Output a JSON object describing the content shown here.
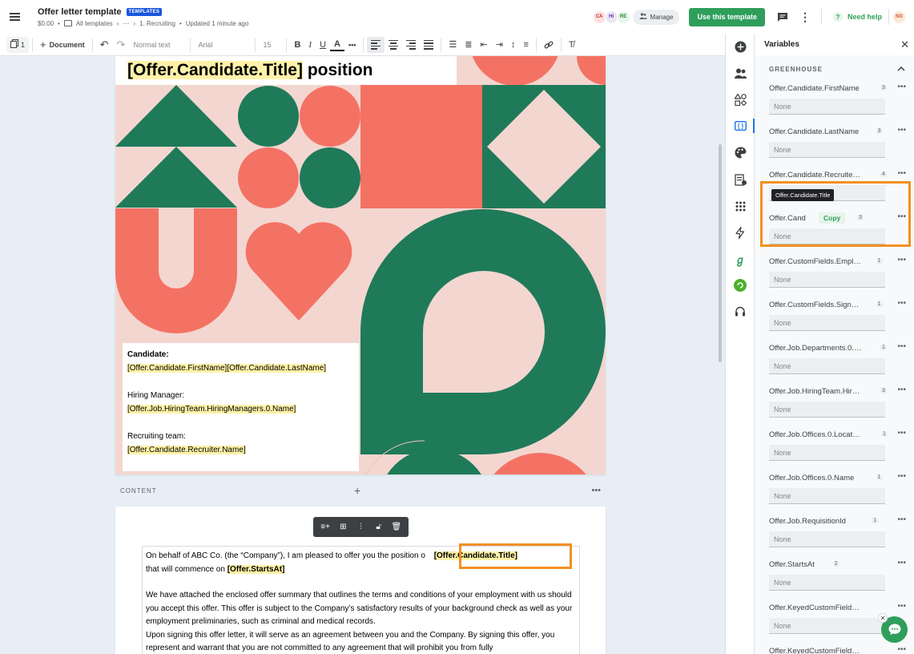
{
  "header": {
    "title": "Offer letter template",
    "tag": "TEMPLATES",
    "price": "$0.00",
    "breadcrumb_folder": "All templates",
    "breadcrumb_more": "⋯",
    "breadcrumb_current": "1. Recruiting",
    "updated": "Updated 1 minute ago",
    "avatars": [
      {
        "initials": "CA",
        "bg": "#fde2e2",
        "color": "#c62828"
      },
      {
        "initials": "HI",
        "bg": "#ede7f6",
        "color": "#5e35b1"
      },
      {
        "initials": "RE",
        "bg": "#e8f5e9",
        "color": "#2e7d32"
      }
    ],
    "manage_label": "Manage",
    "use_template_label": "Use this template",
    "need_help_label": "Need help",
    "user_initials": "NG",
    "accent": "#2f9e5b"
  },
  "toolbar": {
    "pages_count": "1",
    "add_document_label": "Document",
    "style_value": "Normal text",
    "font_value": "Arial",
    "size_value": "15"
  },
  "page1": {
    "heading_var": "[Offer.Candidate.Title]",
    "heading_rest": " position",
    "candidate_label": "Candidate:",
    "candidate_first": "[Offer.Candidate.FirstName]",
    "candidate_last": "[Offer.Candidate.LastName]",
    "hiring_label": "Hiring Manager:",
    "hiring_var": "[Offer.Job.HiringTeam.HiringManagers.0.Name]",
    "recruiting_label": "Recruiting team:",
    "recruiting_var": "[Offer.Candidate.Recruiter.Name]"
  },
  "content_bar": {
    "label": "CONTENT"
  },
  "page2": {
    "p1_text": "On behalf of ABC Co. (the “Company”), I am pleased to offer you the position o",
    "p1_var": "[Offer.Candidate.Title]",
    "p1_text2": "that will commence on ",
    "p1_var2": "[Offer.StartsAt]",
    "p2_text": "We have attached the enclosed offer summary that outlines the terms and conditions of your employment with us should you accept this offer. This offer is subject to the Company’s satisfactory results of your background check as well as your employment preliminaries, such as criminal and medical records.",
    "p3_text": "Upon signing this offer letter, it will serve as an agreement between you and the Company. By signing this offer, you represent and warrant that you are not committed to any agreement that will prohibit you from fully"
  },
  "panel": {
    "title": "Variables",
    "section": "GREENHOUSE",
    "tooltip": "Offer.Candidate.Title",
    "copy_label": "Copy",
    "variables": [
      {
        "label": "Offer.Candidate.FirstName",
        "count": "3",
        "value": "None"
      },
      {
        "label": "Offer.Candidate.LastName",
        "count": "3",
        "value": "None"
      },
      {
        "label": "Offer.Candidate.Recruite…",
        "count": "4",
        "value": "None"
      },
      {
        "label": "Offer.Cand",
        "count": "3",
        "value": "None"
      },
      {
        "label": "Offer.CustomFields.Empl…",
        "count": "1",
        "value": "None"
      },
      {
        "label": "Offer.CustomFields.Sign…",
        "count": "1",
        "value": "None"
      },
      {
        "label": "Offer.Job.Departments.0.…",
        "count": "1",
        "value": "None"
      },
      {
        "label": "Offer.Job.HiringTeam.Hir…",
        "count": "3",
        "value": "None"
      },
      {
        "label": "Offer.Job.Offices.0.Locat…",
        "count": "1",
        "value": "None"
      },
      {
        "label": "Offer.Job.Offices.0.Name",
        "count": "1",
        "value": "None"
      },
      {
        "label": "Offer.Job.RequisitionId",
        "count": "1",
        "value": "None"
      },
      {
        "label": "Offer.StartsAt",
        "count": "2",
        "value": "None"
      },
      {
        "label": "Offer.KeyedCustomField…",
        "count": "",
        "value": "None"
      },
      {
        "label": "Offer.KeyedCustomField…",
        "count": "",
        "value": ""
      }
    ]
  },
  "colors": {
    "green": "#1f7a5a",
    "coral": "#f47264",
    "pink": "#f3d6d0",
    "highlight": "#fff2a8",
    "callout": "#f29022"
  }
}
